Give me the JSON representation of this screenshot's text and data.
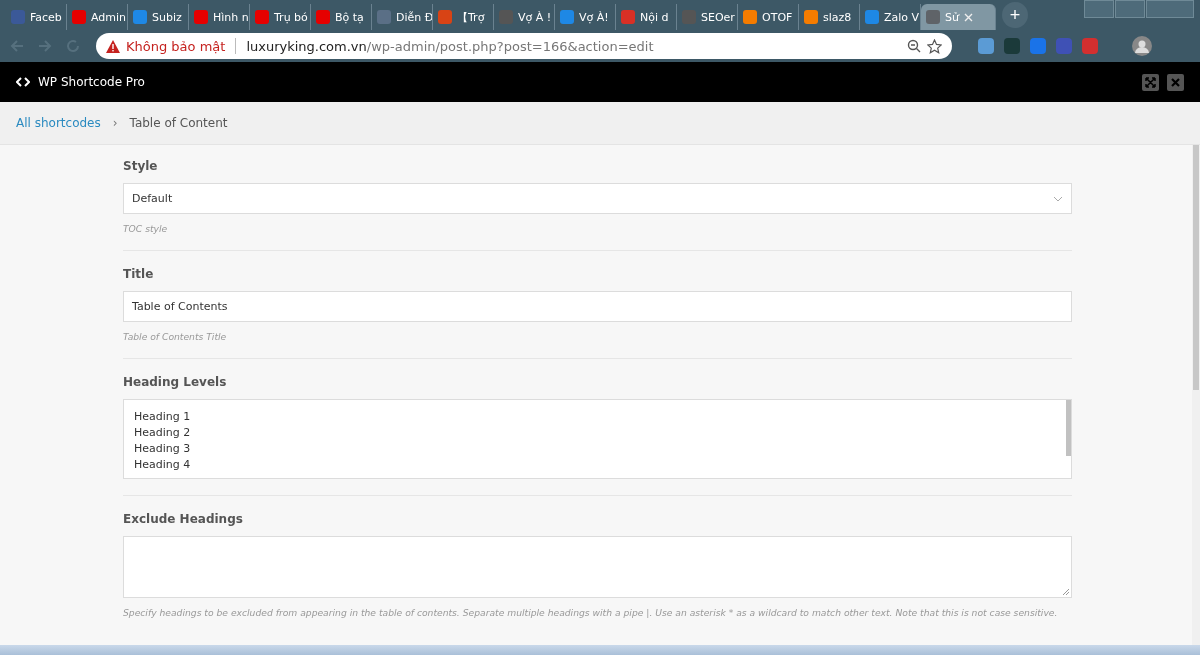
{
  "browser": {
    "tabs": [
      {
        "label": "Faceb",
        "color": "#3b5998",
        "selected": false
      },
      {
        "label": "Admin",
        "color": "#e60000",
        "selected": false
      },
      {
        "label": "Subiz",
        "color": "#1e88e5",
        "selected": false
      },
      {
        "label": "Hình n",
        "color": "#e60000",
        "selected": false
      },
      {
        "label": "Trụ bó",
        "color": "#e60000",
        "selected": false
      },
      {
        "label": "Bộ tạ",
        "color": "#e60000",
        "selected": false
      },
      {
        "label": "Diễn Đ",
        "color": "#5a6f86",
        "selected": false
      },
      {
        "label": "【Trợ",
        "color": "#d84315",
        "selected": false
      },
      {
        "label": "Vợ À !",
        "color": "#555555",
        "selected": false
      },
      {
        "label": "Vợ À!",
        "color": "#1e88e5",
        "selected": false
      },
      {
        "label": "Nội d",
        "color": "#d93025",
        "selected": false
      },
      {
        "label": "SEOer",
        "color": "#555555",
        "selected": false
      },
      {
        "label": "OTOF",
        "color": "#f57c00",
        "selected": false
      },
      {
        "label": "slaz8",
        "color": "#f57c00",
        "selected": false
      },
      {
        "label": "Zalo V",
        "color": "#1e88e5",
        "selected": false
      },
      {
        "label": "Sử",
        "color": "#5f6368",
        "selected": true
      }
    ],
    "new_tab": "+",
    "security": "Không bảo mật",
    "url_host": "luxuryking.com.vn",
    "url_path": "/wp-admin/post.php?post=166&action=edit"
  },
  "app": {
    "title": "WP Shortcode Pro"
  },
  "breadcrumb": {
    "link": "All shortcodes",
    "separator": "›",
    "current": "Table of Content"
  },
  "fields": [
    {
      "kind": "select",
      "label": "Style",
      "value": "Default",
      "help": "TOC style"
    },
    {
      "kind": "text",
      "label": "Title",
      "value": "Table of Contents",
      "help": "Table of Contents Title"
    },
    {
      "kind": "list",
      "label": "Heading Levels",
      "options": [
        "Heading 1",
        "Heading 2",
        "Heading 3",
        "Heading 4"
      ]
    },
    {
      "kind": "textarea",
      "label": "Exclude Headings",
      "help": "Specify headings to be excluded from appearing in the table of contents. Separate multiple headings with a pipe |. Use an asterisk * as a wildcard to match other text. Note that this is not case sensitive."
    }
  ]
}
